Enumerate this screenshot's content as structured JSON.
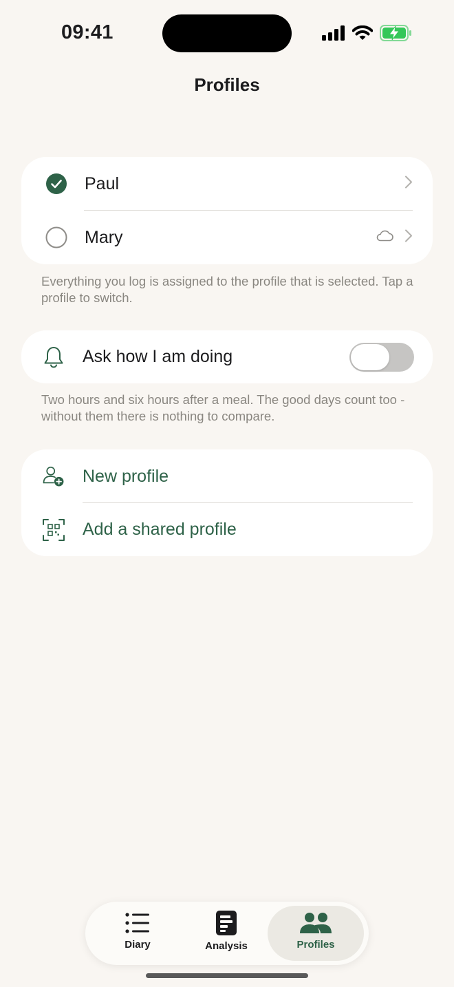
{
  "status_bar": {
    "time": "09:41"
  },
  "nav": {
    "title": "Profiles"
  },
  "profiles": {
    "items": [
      {
        "name": "Paul",
        "selected": true,
        "shared": false
      },
      {
        "name": "Mary",
        "selected": false,
        "shared": true
      }
    ],
    "footnote": "Everything you log is assigned to the profile that is selected. Tap a profile to switch."
  },
  "reminder": {
    "label": "Ask how I am doing",
    "enabled": false,
    "footnote": "Two hours and six hours after a meal. The good days count too - without them there is nothing to compare."
  },
  "actions": {
    "new_profile": "New profile",
    "add_shared": "Add a shared profile"
  },
  "tabbar": {
    "tabs": [
      {
        "label": "Diary",
        "icon": "list-icon",
        "active": false
      },
      {
        "label": "Analysis",
        "icon": "analysis-icon",
        "active": false
      },
      {
        "label": "Profiles",
        "icon": "people-icon",
        "active": true
      }
    ]
  },
  "colors": {
    "accent": "#2e6248",
    "background": "#f9f6f2",
    "battery": "#34c759"
  }
}
